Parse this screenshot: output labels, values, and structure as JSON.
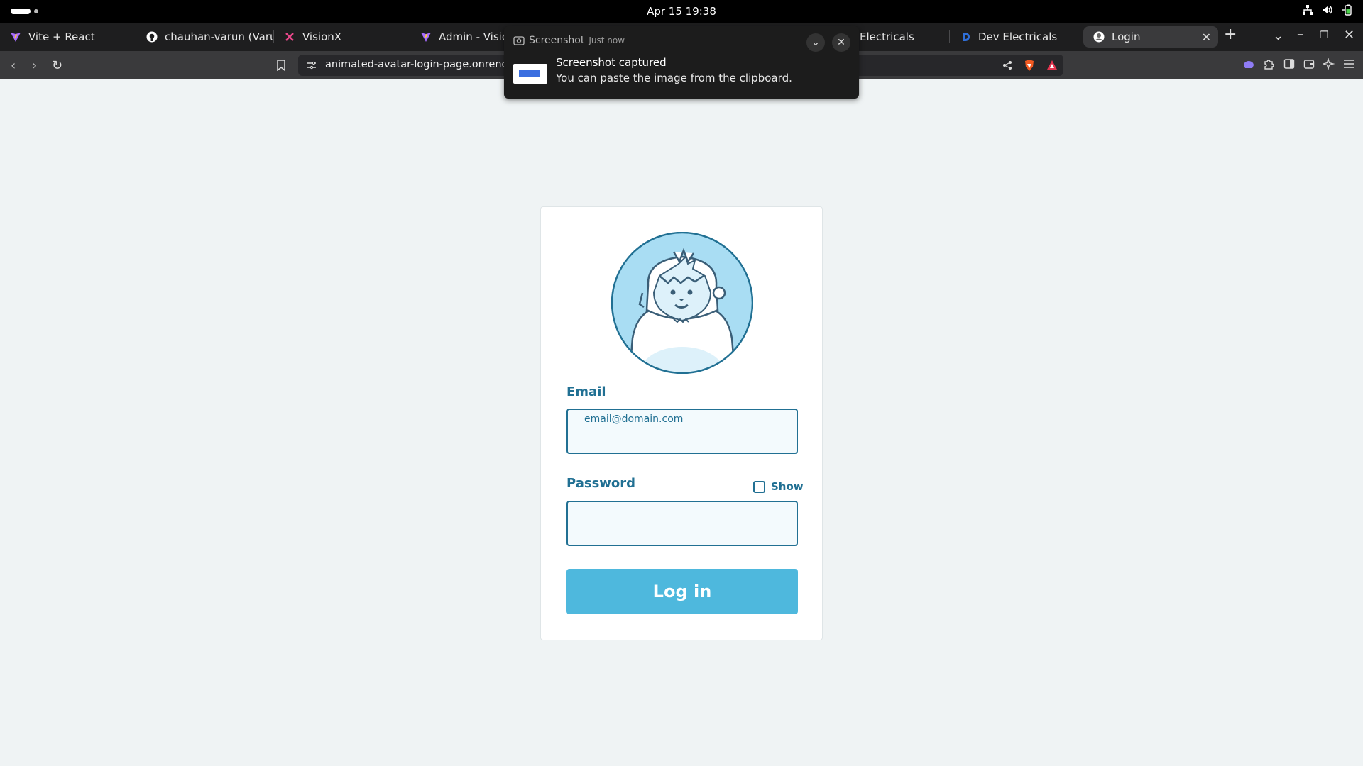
{
  "system": {
    "clock": "Apr 15  19:38"
  },
  "browser": {
    "tabs": [
      {
        "label": "Vite + React",
        "icon": "vite-icon"
      },
      {
        "label": "chauhan-varun (Varu",
        "icon": "github-icon"
      },
      {
        "label": "VisionX",
        "icon": "visionx-icon"
      },
      {
        "label": "Admin - Vision",
        "icon": "vite-icon"
      },
      {
        "label": "Electricals",
        "icon": "generic-icon"
      },
      {
        "label": "Dev Electricals",
        "icon": "dev-electricals-icon"
      },
      {
        "label": "Login",
        "icon": "avatar-favicon",
        "active": true
      }
    ],
    "url": "animated-avatar-login-page.onrender.com"
  },
  "notification": {
    "app": "Screenshot",
    "time": "Just now",
    "title": "Screenshot captured",
    "body": "You can paste the image from the clipboard."
  },
  "login": {
    "email_label": "Email",
    "email_placeholder": "email@domain.com",
    "password_label": "Password",
    "show_label": "Show",
    "submit_label": "Log in"
  },
  "colors": {
    "accent": "#217093",
    "button": "#4eb8dd",
    "page_bg": "#eff3f4"
  }
}
